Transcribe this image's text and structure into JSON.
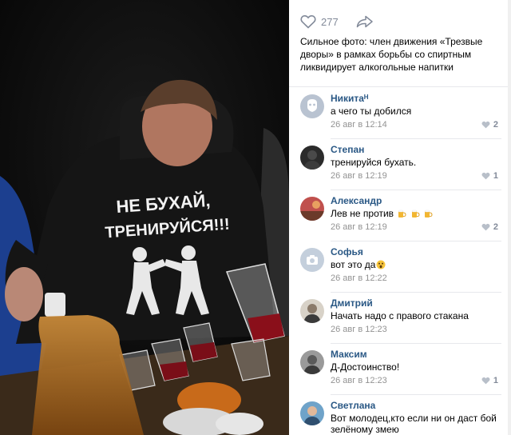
{
  "photo": {
    "shirt_text_line1": "НЕ БУХАЙ,",
    "shirt_text_line2": "ТРЕНИРУЙСЯ!!!"
  },
  "actions": {
    "like_count": "277",
    "like_icon": "heart-icon",
    "share_icon": "share-arrow-icon"
  },
  "caption": "Сильное фото: член движения «Трезвые дворы» в рамках борьбы со спиртным ликвидирует алкогольные напитки",
  "comments": [
    {
      "name": "Никитаᴴ",
      "text": "а чего ты добился",
      "date": "26 авг в 12:14",
      "likes": "2",
      "avatar_color": "#b9c3d1"
    },
    {
      "name": "Степан",
      "text": "тренируйся бухать.",
      "date": "26 авг в 12:19",
      "likes": "1",
      "avatar_color": "#2b2b2b"
    },
    {
      "name": "Александр",
      "text": "Лев не против",
      "date": "26 авг в 12:19",
      "likes": "2",
      "avatar_color": "#c0504d"
    },
    {
      "name": "Софья",
      "text": "вот это да",
      "date": "26 авг в 12:22",
      "likes": "",
      "avatar_color": "#c4cfdc"
    },
    {
      "name": "Дмитрий",
      "text": "Начать надо с правого стакана",
      "date": "26 авг в 12:23",
      "likes": "",
      "avatar_color": "#8a7a6a"
    },
    {
      "name": "Максим",
      "text": "Д-Достоинство!",
      "date": "26 авг в 12:23",
      "likes": "1",
      "avatar_color": "#5a5a5a"
    },
    {
      "name": "Светлана",
      "text": "Вот молодец,кто если ни он даст бой",
      "text2": "зелёному змею",
      "date": "",
      "likes": "",
      "avatar_color": "#6fa3c9"
    }
  ],
  "colors": {
    "link": "#2a5885",
    "muted": "#939393",
    "divider": "#e7e8ec"
  }
}
